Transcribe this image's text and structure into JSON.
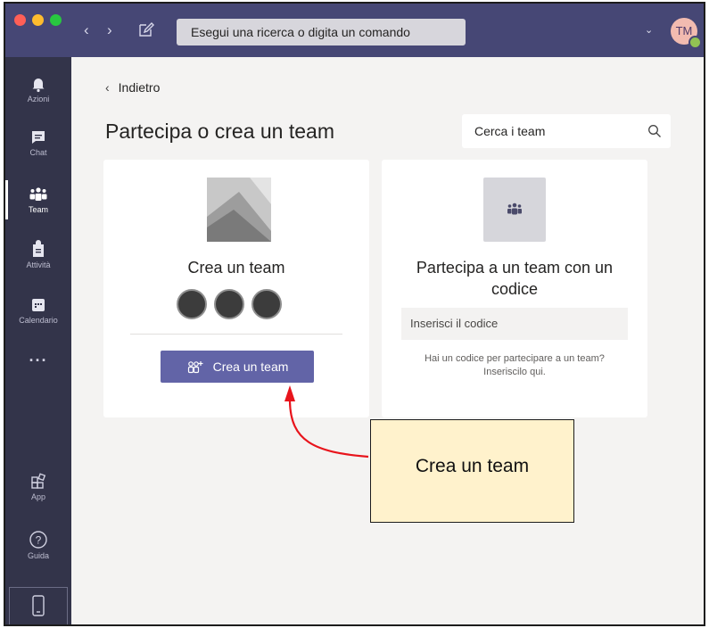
{
  "titlebar": {
    "search_placeholder": "Esegui una ricerca o digita un comando",
    "avatar_initials": "TM",
    "traffic_lights": [
      "#ff5f57",
      "#febc2e",
      "#28c840"
    ],
    "back_icon": "chevron-left-icon",
    "forward_icon": "chevron-right-icon",
    "compose_icon": "compose-icon"
  },
  "rail": {
    "items": [
      {
        "label": "Azioni",
        "icon": "bell-icon"
      },
      {
        "label": "Chat",
        "icon": "chat-icon"
      },
      {
        "label": "Team",
        "icon": "team-icon",
        "active": true
      },
      {
        "label": "Attività",
        "icon": "briefcase-icon"
      },
      {
        "label": "Calendario",
        "icon": "calendar-icon"
      }
    ],
    "more": "···",
    "bottom": [
      {
        "label": "App",
        "icon": "apps-icon"
      },
      {
        "label": "Guida",
        "icon": "help-icon"
      }
    ],
    "device_icon": "mobile-device-icon"
  },
  "main": {
    "back_label": "Indietro",
    "title": "Partecipa o crea un team",
    "team_search_placeholder": "Cerca i team",
    "create_card": {
      "title": "Crea un team",
      "button_label": "Crea un team"
    },
    "join_card": {
      "title_line1": "Partecipa a un team con un",
      "title_line2": "codice",
      "input_placeholder": "Inserisci il codice",
      "hint_line1": "Hai un codice per partecipare a un team?",
      "hint_line2": "Inseriscilo qui."
    }
  },
  "callout": {
    "text": "Crea un team"
  },
  "colors": {
    "titlebar": "#464775",
    "rail": "#33344a",
    "accent": "#6264a7",
    "callout_fill": "#fff2cc",
    "arrow": "#e8141c"
  }
}
